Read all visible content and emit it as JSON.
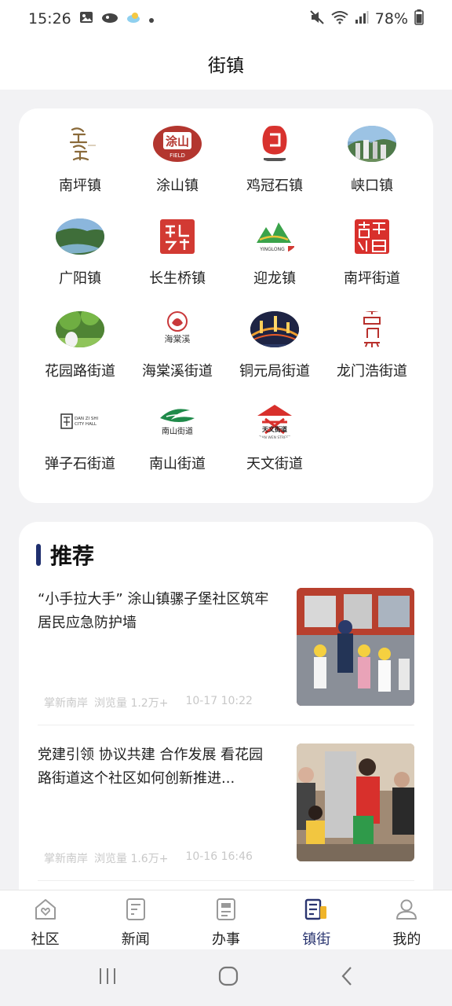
{
  "status": {
    "time": "15:26",
    "battery": "78%"
  },
  "header": {
    "title": "街镇"
  },
  "towns": [
    {
      "name": "南坪镇",
      "icon": "nanping-town-logo"
    },
    {
      "name": "涂山镇",
      "icon": "tushan-town-logo",
      "logo_text": "涂山",
      "logo_subtext": "FIELD"
    },
    {
      "name": "鸡冠石镇",
      "icon": "jiguanshi-town-logo"
    },
    {
      "name": "峡口镇",
      "icon": "xiakou-town-logo"
    },
    {
      "name": "广阳镇",
      "icon": "guangyang-town-logo"
    },
    {
      "name": "长生桥镇",
      "icon": "changshengqiao-town-logo"
    },
    {
      "name": "迎龙镇",
      "icon": "yinglong-town-logo",
      "logo_text": "YINGLONG"
    },
    {
      "name": "南坪街道",
      "icon": "nanping-street-logo"
    },
    {
      "name": "花园路街道",
      "icon": "huayuanlu-street-logo"
    },
    {
      "name": "海棠溪街道",
      "icon": "haitangxi-street-logo",
      "logo_text": "海棠溪"
    },
    {
      "name": "铜元局街道",
      "icon": "tongyuanju-street-logo"
    },
    {
      "name": "龙门浩街道",
      "icon": "longmenhao-street-logo"
    },
    {
      "name": "弹子石街道",
      "icon": "danzishi-street-logo",
      "logo_text": "DAN ZI SHI",
      "logo_subtext": "CITY HALL"
    },
    {
      "name": "南山街道",
      "icon": "nanshan-street-logo",
      "logo_text": "南山街道"
    },
    {
      "name": "天文街道",
      "icon": "tianwen-street-logo",
      "logo_text": "天文街道",
      "logo_subtext": "TIAN WEN STREET"
    }
  ],
  "recommend": {
    "title": "推荐",
    "items": [
      {
        "title": "“小手拉大手” 涂山镇骡子堡社区筑牢居民应急防护墙",
        "source": "掌新南岸",
        "views": "浏览量 1.2万+",
        "time": "10-17 10:22",
        "thumb": "fire-station-children-photo"
      },
      {
        "title": "党建引领 协议共建 合作发展 看花园路街道这个社区如何创新推进...",
        "source": "掌新南岸",
        "views": "浏览量 1.6万+",
        "time": "10-16 16:46",
        "thumb": "community-visit-photo"
      }
    ]
  },
  "tabs": [
    {
      "label": "社区",
      "icon": "home-heart-icon"
    },
    {
      "label": "新闻",
      "icon": "news-doc-icon"
    },
    {
      "label": "办事",
      "icon": "service-doc-icon"
    },
    {
      "label": "镇街",
      "icon": "town-street-icon",
      "active": true
    },
    {
      "label": "我的",
      "icon": "user-icon"
    }
  ],
  "colors": {
    "accent": "#2a3570",
    "background": "#f2f2f4",
    "card": "#ffffff"
  }
}
